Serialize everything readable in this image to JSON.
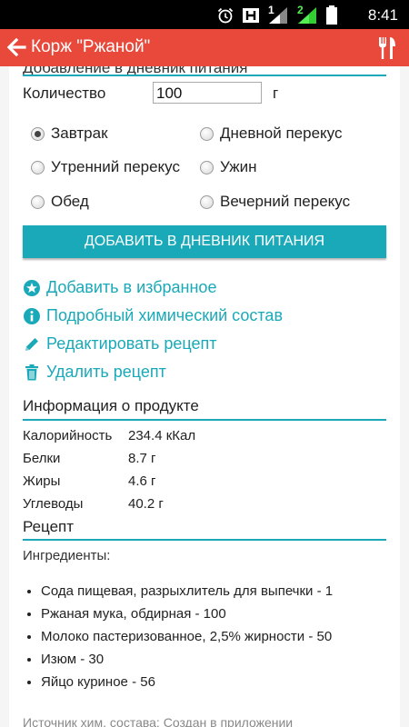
{
  "status_bar": {
    "time": "8:41",
    "icons": [
      "alarm-icon",
      "h-network-icon",
      "signal-sim1-icon",
      "signal-sim2-icon",
      "battery-icon"
    ],
    "sim1_label": "1",
    "sim2_label": "2"
  },
  "app_bar": {
    "title": "Корж \"Ржаной\"",
    "background": "#e8493a"
  },
  "form": {
    "section_heading": "Добавление в дневник питания",
    "quantity_label": "Количество",
    "quantity_value": "100",
    "quantity_unit": "г",
    "meals": [
      {
        "label": "Завтрак",
        "selected": true
      },
      {
        "label": "Дневной перекус",
        "selected": false
      },
      {
        "label": "Утренний перекус",
        "selected": false
      },
      {
        "label": "Ужин",
        "selected": false
      },
      {
        "label": "Обед",
        "selected": false
      },
      {
        "label": "Вечерний перекус",
        "selected": false
      }
    ],
    "add_button": "ДОБАВИТЬ В ДНЕВНИК ПИТАНИЯ"
  },
  "actions": {
    "favorite": "Добавить в избранное",
    "composition": "Подробный химический состав",
    "edit": "Редактировать рецепт",
    "delete": "Удалить рецепт"
  },
  "product_info": {
    "title": "Информация о продукте",
    "rows": [
      {
        "label": "Калорийность",
        "value": "234.4 кКал"
      },
      {
        "label": "Белки",
        "value": "8.7 г"
      },
      {
        "label": "Жиры",
        "value": "4.6 г"
      },
      {
        "label": "Углеводы",
        "value": "40.2 г"
      }
    ]
  },
  "recipe": {
    "title": "Рецепт",
    "ingredients_label": "Ингредиенты:",
    "ingredients": [
      "Сода пищевая, разрыхлитель для выпечки - 1",
      "Ржаная мука, обдирная - 100",
      "Молоко пастеризованное, 2,5% жирности - 50",
      "Изюм - 30",
      "Яйцо куриное - 56"
    ],
    "source": "Источник хим. состава: Создан в приложении"
  },
  "colors": {
    "accent": "#1aa9b8",
    "app_bar": "#e8493a"
  }
}
